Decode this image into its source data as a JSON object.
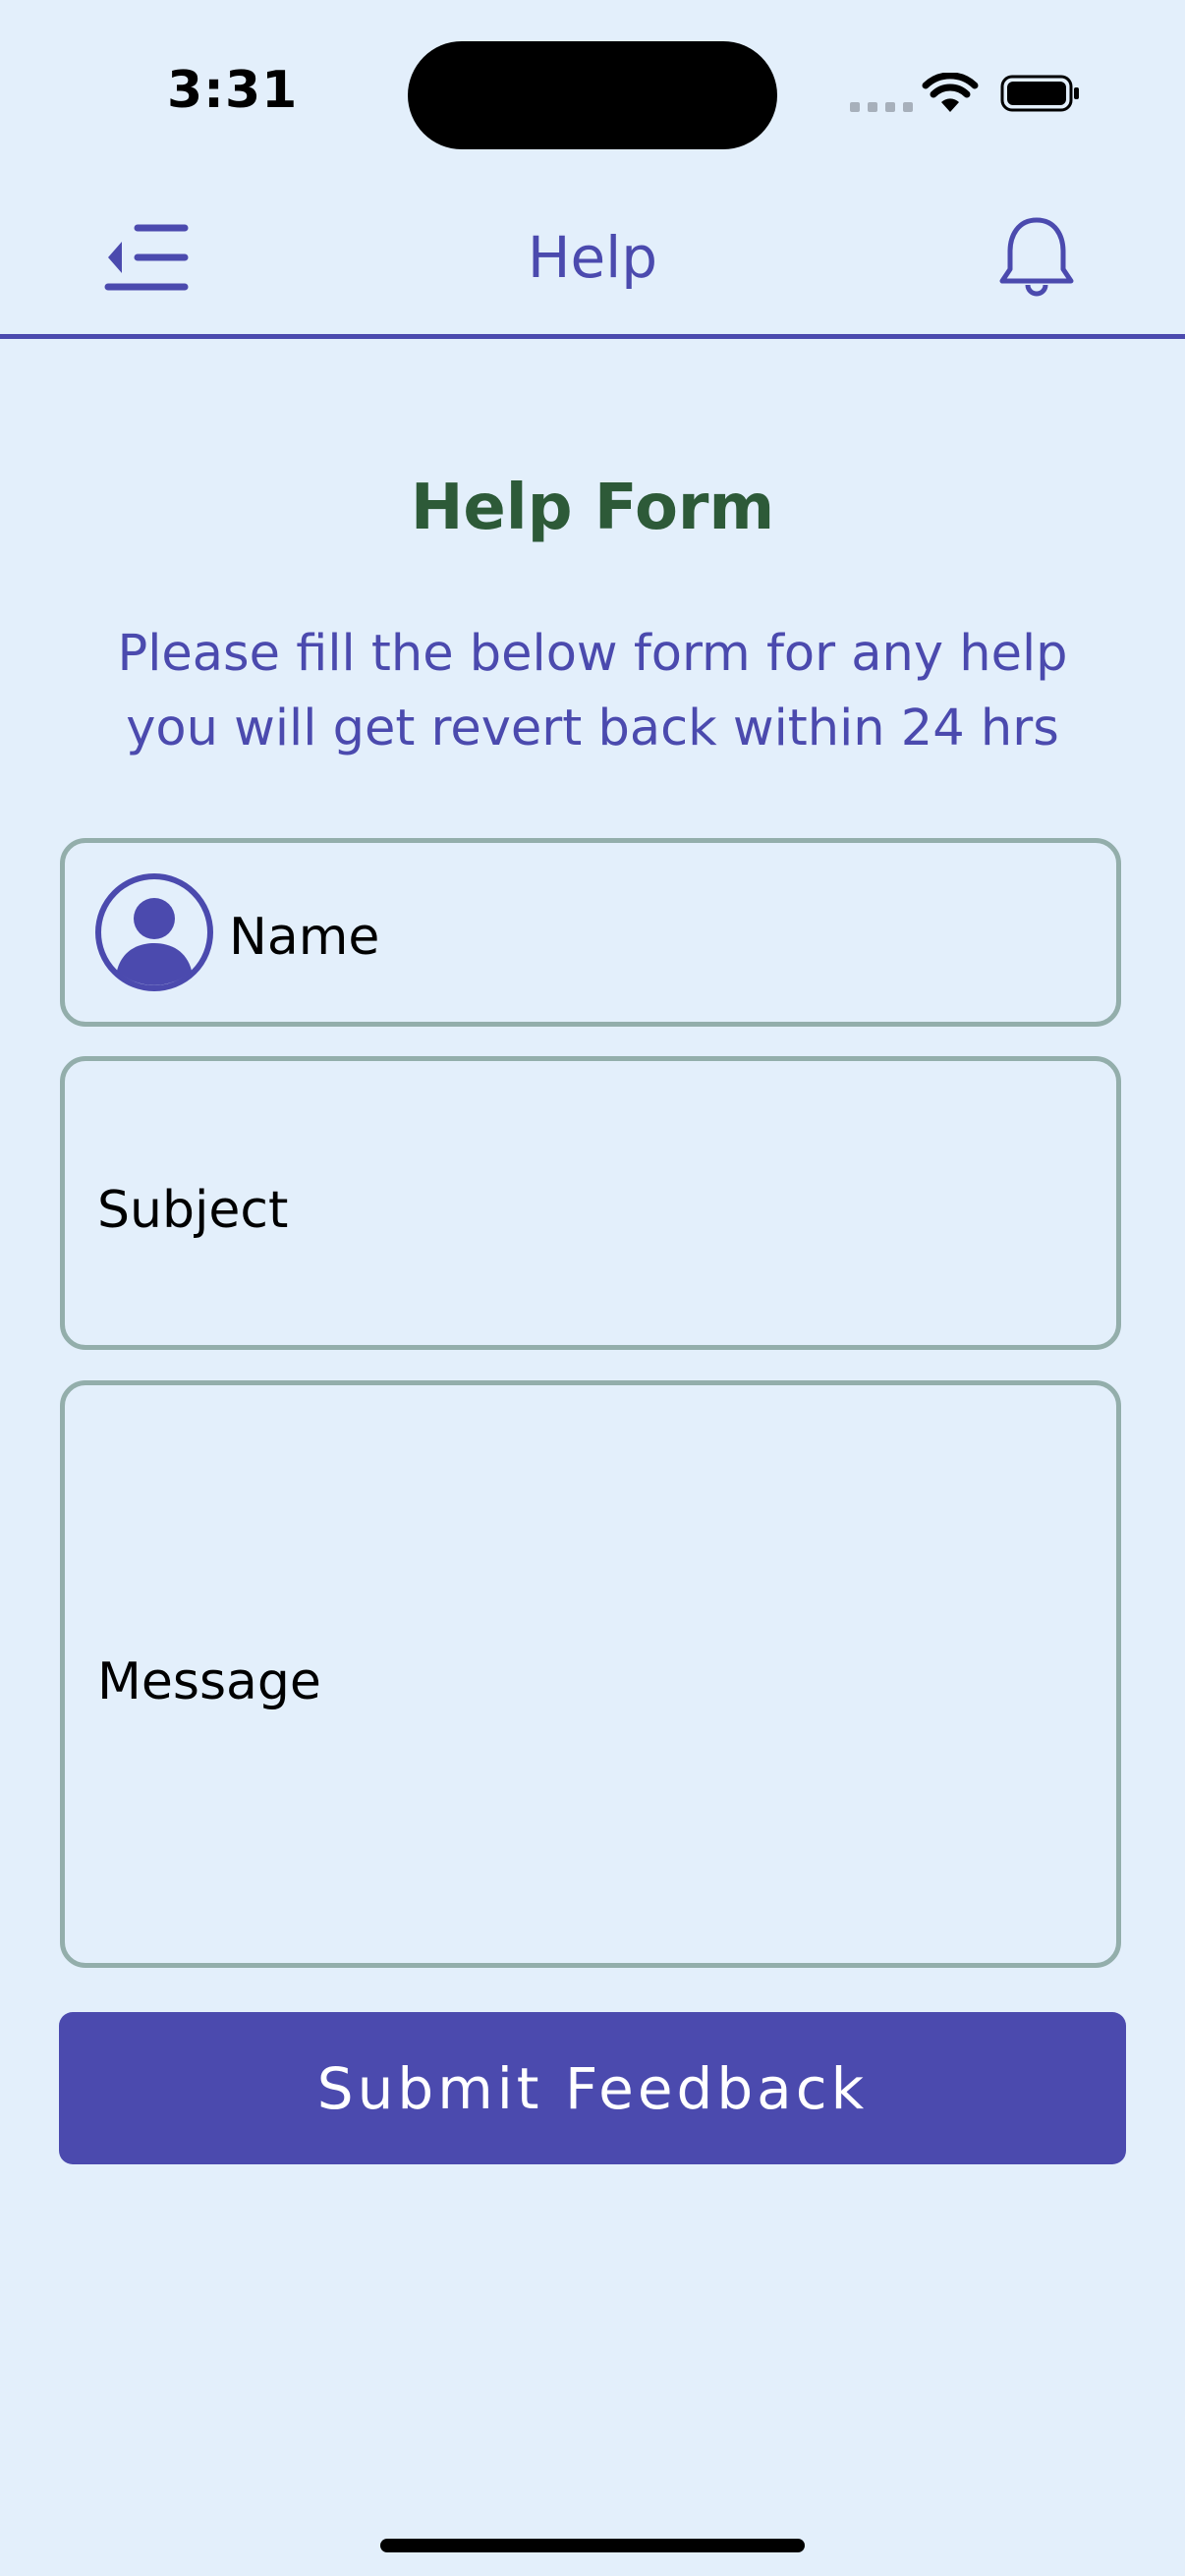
{
  "status_bar": {
    "time": "3:31"
  },
  "nav": {
    "title": "Help",
    "menu_icon": "menu-collapse-icon",
    "bell_icon": "bell-icon"
  },
  "form": {
    "title": "Help Form",
    "description": "Please fill the below form for any help you will get revert back within 24 hrs",
    "name_placeholder": "Name",
    "subject_placeholder": "Subject",
    "message_placeholder": "Message",
    "submit_label": "Submit Feedback"
  },
  "colors": {
    "background": "#e3effb",
    "accent": "#4b4aae",
    "title_green": "#2d5a38",
    "field_border": "#93aeab"
  }
}
